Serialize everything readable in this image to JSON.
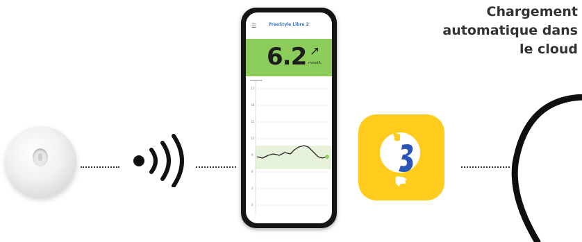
{
  "headline": {
    "line1": "Chargement",
    "line2": "automatique dans",
    "line3": "le cloud"
  },
  "phone": {
    "brand": "FreeStyle Libre 2",
    "glucose_value": "6.2",
    "trend_arrow": "↗",
    "unit": "mmol/L",
    "menu_icon": "☰",
    "axis_labels": [
      "21",
      "18",
      "15",
      "12",
      "9",
      "6",
      "3",
      "0"
    ]
  },
  "icons": {
    "sensor": "sensor-device",
    "signal": "nfc-signal-icon",
    "app": "librelinkup-app-icon",
    "cloud": "cloud-arc-icon"
  },
  "colors": {
    "reading_background": "#8ccc5a",
    "app_icon_background": "#ffcc1e",
    "brand_blue": "#2a56b8",
    "target_range": "#e7f2da"
  }
}
